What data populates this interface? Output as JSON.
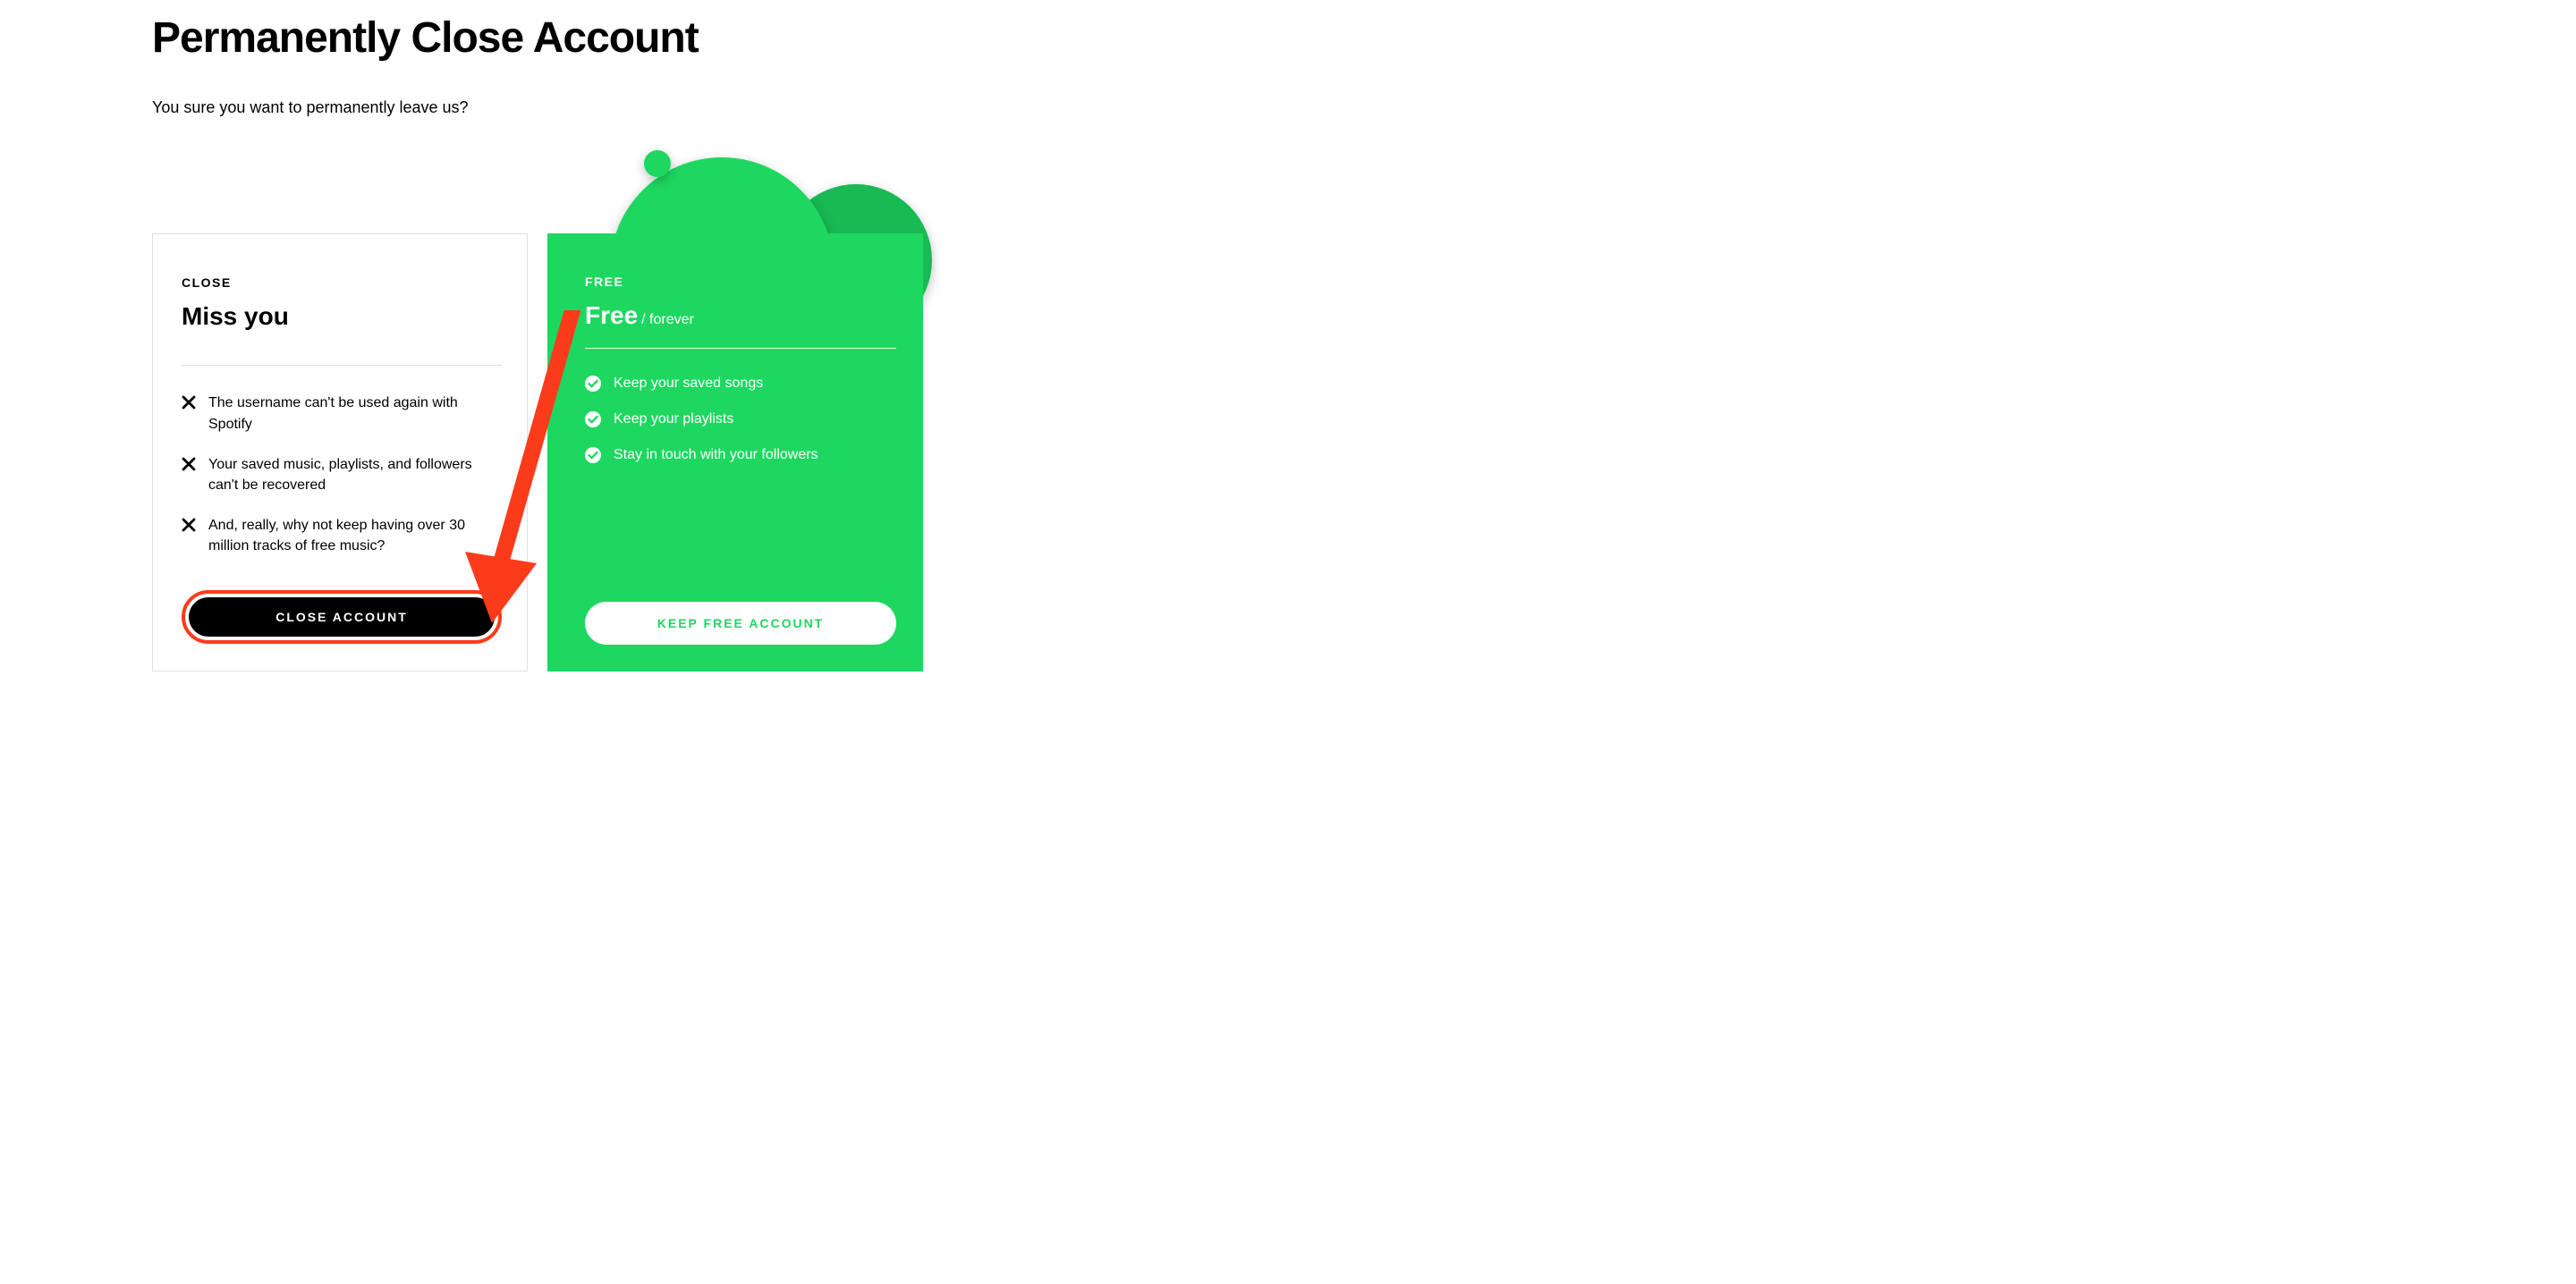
{
  "page": {
    "title": "Permanently Close Account",
    "subheading": "You sure you want to permanently leave us?"
  },
  "close_card": {
    "label": "CLOSE",
    "title": "Miss you",
    "items": [
      "The username can't be used again with Spotify",
      "Your saved music, playlists, and followers can't be recovered",
      "And, really, why not keep having over 30 million tracks of free music?"
    ],
    "button": "CLOSE ACCOUNT"
  },
  "free_card": {
    "label": "FREE",
    "title": "Free",
    "title_sub": "/ forever",
    "items": [
      "Keep your saved songs",
      "Keep your playlists",
      "Stay in touch with your followers"
    ],
    "button": "KEEP FREE ACCOUNT"
  },
  "colors": {
    "accent_green": "#1ed760",
    "annotation_red": "#fc3b1b"
  }
}
